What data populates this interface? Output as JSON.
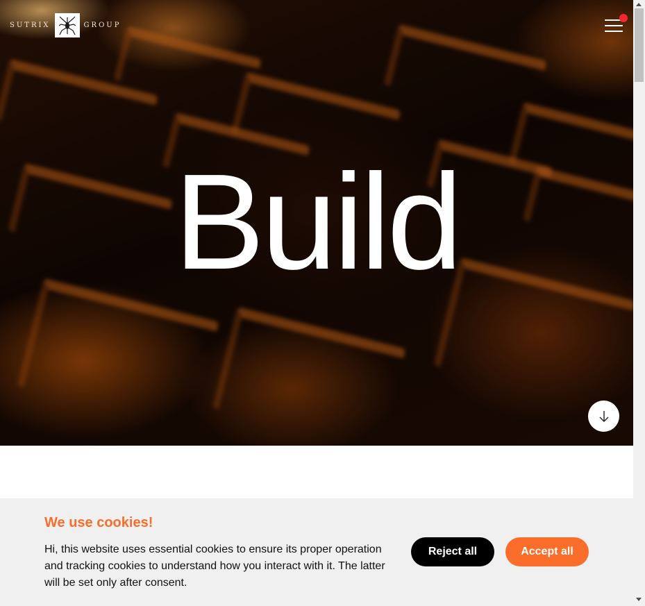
{
  "header": {
    "logo_left": "SUTRIX",
    "logo_right": "GROUP",
    "logo_icon": "spider-icon",
    "menu_icon": "hamburger-menu-icon",
    "notification_color": "#f2272f"
  },
  "hero": {
    "headline": "Build",
    "scroll_icon": "arrow-down-icon"
  },
  "cookie_banner": {
    "title": "We use cookies!",
    "body": "Hi, this website uses essential cookies to ensure its proper operation and tracking cookies to understand how you interact with it. The latter will be set only after consent.",
    "reject_label": "Reject all",
    "accept_label": "Accept all",
    "accent_color": "#fa6d2a"
  }
}
